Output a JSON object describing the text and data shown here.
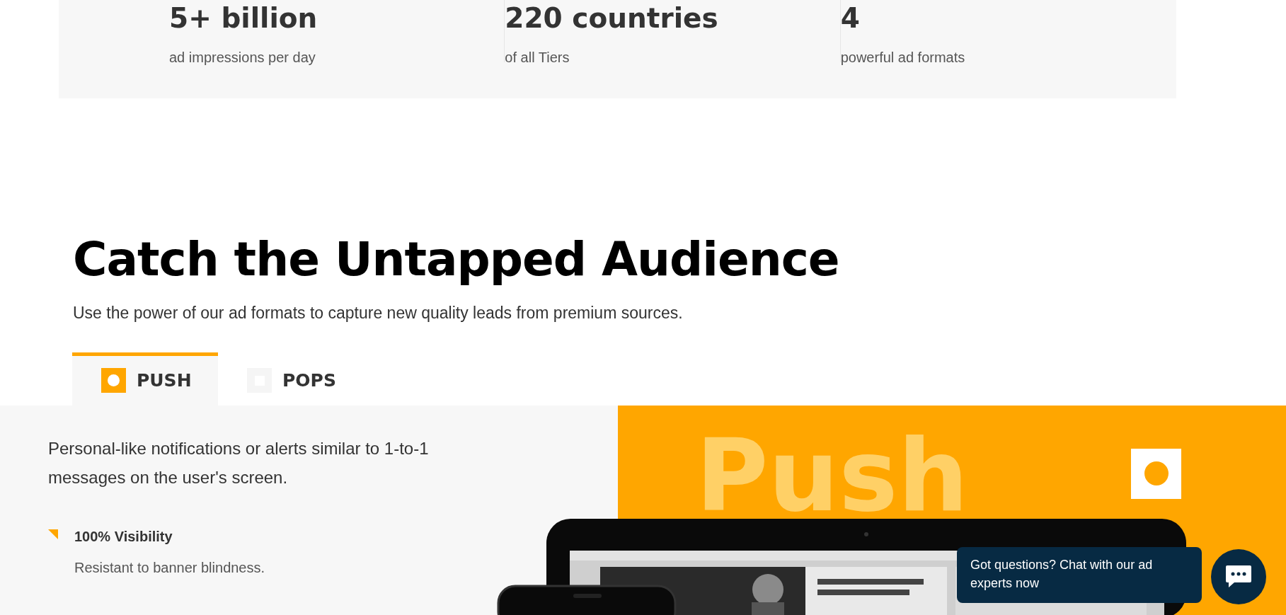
{
  "stats": [
    {
      "value": "5+ billion",
      "label": "ad impressions per day"
    },
    {
      "value": "220 countries",
      "label": "of all Tiers"
    },
    {
      "value": "4",
      "label": "powerful ad formats"
    }
  ],
  "section": {
    "title": "Catch the Untapped Audience",
    "subtitle": "Use the power of our ad formats to capture new quality leads from premium sources."
  },
  "tabs": [
    {
      "label": "PUSH",
      "selected": true
    },
    {
      "label": "POPS",
      "selected": false
    }
  ],
  "panel": {
    "description": "Personal-like notifications or alerts similar to 1-to-1 messages on the user's screen.",
    "features": [
      {
        "title": "100% Visibility",
        "text": "Resistant to banner blindness."
      }
    ],
    "banner_word": "Push"
  },
  "chat": {
    "message": "Got questions? Chat with our ad experts now"
  }
}
